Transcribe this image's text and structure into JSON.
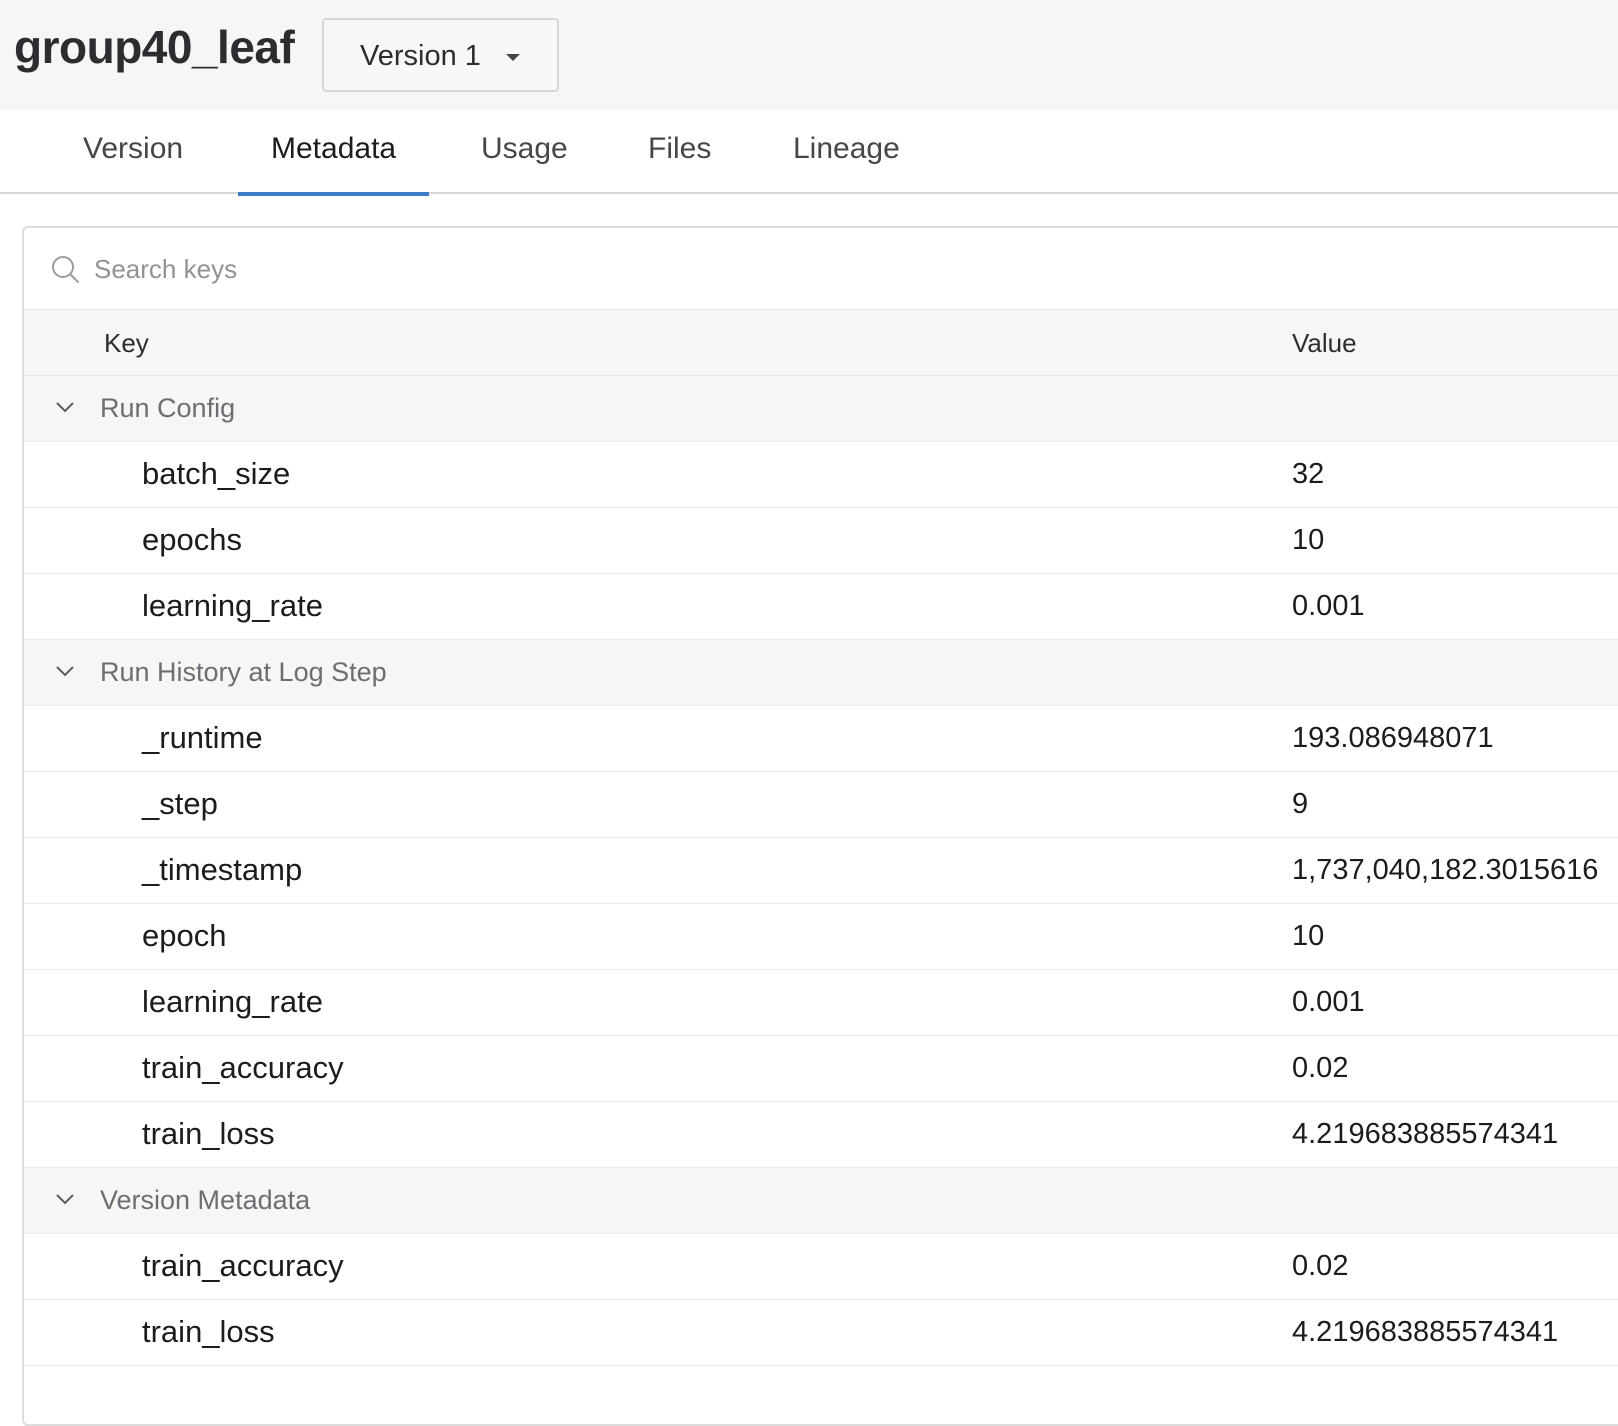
{
  "header": {
    "title": "group40_leaf",
    "version_label": "Version 1"
  },
  "tabs": [
    {
      "label": "Version",
      "active": false
    },
    {
      "label": "Metadata",
      "active": true
    },
    {
      "label": "Usage",
      "active": false
    },
    {
      "label": "Files",
      "active": false
    },
    {
      "label": "Lineage",
      "active": false
    }
  ],
  "search": {
    "placeholder": "Search keys",
    "value": ""
  },
  "table": {
    "headers": {
      "key": "Key",
      "value": "Value"
    },
    "groups": [
      {
        "name": "Run Config",
        "expanded": true,
        "rows": [
          {
            "key": "batch_size",
            "value": "32"
          },
          {
            "key": "epochs",
            "value": "10"
          },
          {
            "key": "learning_rate",
            "value": "0.001"
          }
        ]
      },
      {
        "name": "Run History at Log Step",
        "expanded": true,
        "rows": [
          {
            "key": "_runtime",
            "value": "193.086948071"
          },
          {
            "key": "_step",
            "value": "9"
          },
          {
            "key": "_timestamp",
            "value": "1,737,040,182.3015616"
          },
          {
            "key": "epoch",
            "value": "10"
          },
          {
            "key": "learning_rate",
            "value": "0.001"
          },
          {
            "key": "train_accuracy",
            "value": "0.02"
          },
          {
            "key": "train_loss",
            "value": "4.219683885574341"
          }
        ]
      },
      {
        "name": "Version Metadata",
        "expanded": true,
        "rows": [
          {
            "key": "train_accuracy",
            "value": "0.02"
          },
          {
            "key": "train_loss",
            "value": "4.219683885574341"
          }
        ]
      }
    ]
  },
  "colors": {
    "accent": "#3b7bc4",
    "header_bg": "#f6f6f6",
    "group_text": "#6b6e72"
  },
  "icons": {
    "search": "search-icon",
    "chevron": "chevron-down-icon",
    "caret": "caret-down-icon"
  }
}
